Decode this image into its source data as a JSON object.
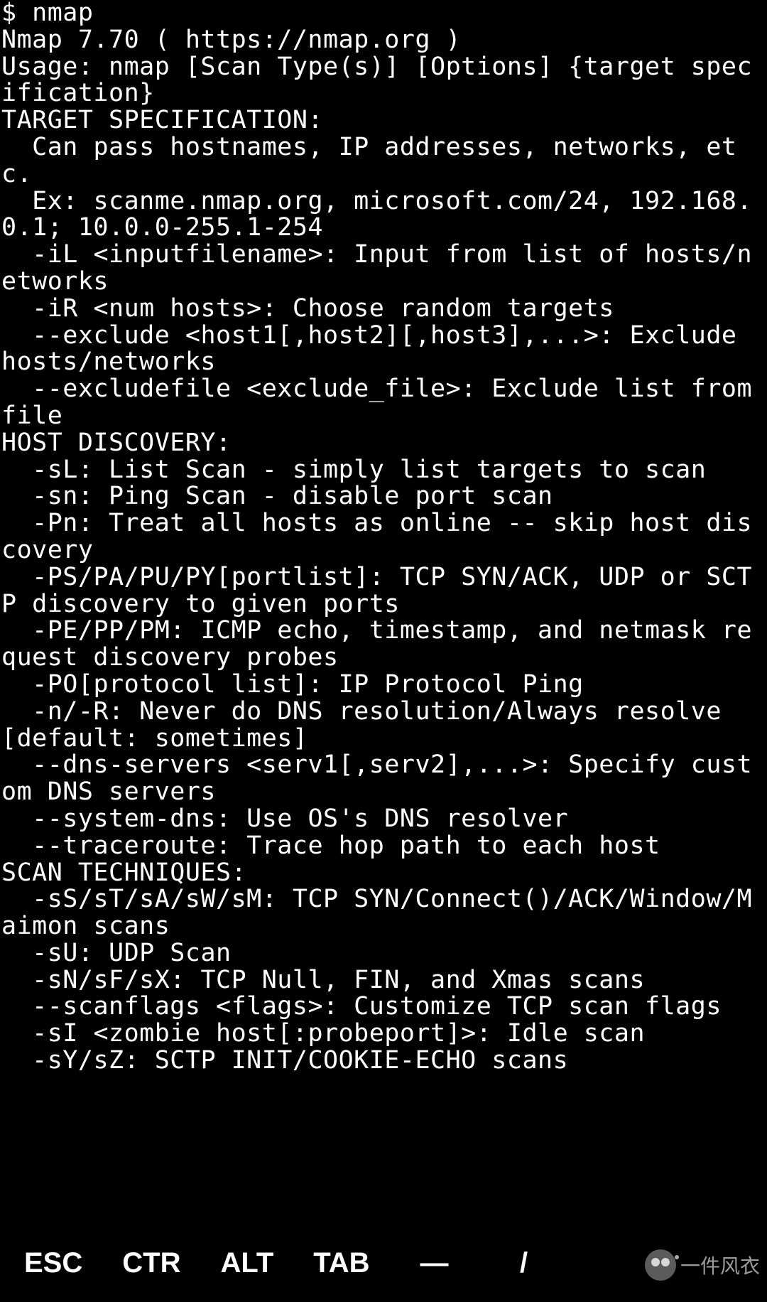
{
  "terminal": {
    "content": "$ nmap\nNmap 7.70 ( https://nmap.org )\nUsage: nmap [Scan Type(s)] [Options] {target specification}\nTARGET SPECIFICATION:\n  Can pass hostnames, IP addresses, networks, etc.\n  Ex: scanme.nmap.org, microsoft.com/24, 192.168.0.1; 10.0.0-255.1-254\n  -iL <inputfilename>: Input from list of hosts/networks\n  -iR <num hosts>: Choose random targets\n  --exclude <host1[,host2][,host3],...>: Exclude hosts/networks\n  --excludefile <exclude_file>: Exclude list from file\nHOST DISCOVERY:\n  -sL: List Scan - simply list targets to scan\n  -sn: Ping Scan - disable port scan\n  -Pn: Treat all hosts as online -- skip host discovery\n  -PS/PA/PU/PY[portlist]: TCP SYN/ACK, UDP or SCTP discovery to given ports\n  -PE/PP/PM: ICMP echo, timestamp, and netmask request discovery probes\n  -PO[protocol list]: IP Protocol Ping\n  -n/-R: Never do DNS resolution/Always resolve [default: sometimes]\n  --dns-servers <serv1[,serv2],...>: Specify custom DNS servers\n  --system-dns: Use OS's DNS resolver\n  --traceroute: Trace hop path to each host\nSCAN TECHNIQUES:\n  -sS/sT/sA/sW/sM: TCP SYN/Connect()/ACK/Window/Maimon scans\n  -sU: UDP Scan\n  -sN/sF/sX: TCP Null, FIN, and Xmas scans\n  --scanflags <flags>: Customize TCP scan flags\n  -sI <zombie host[:probeport]>: Idle scan\n  -sY/sZ: SCTP INIT/COOKIE-ECHO scans"
  },
  "keybar": {
    "esc": "ESC",
    "ctr": "CTR",
    "alt": "ALT",
    "tab": "TAB",
    "dash": "—",
    "slash": "/"
  },
  "watermark": {
    "text": "一件风衣"
  }
}
